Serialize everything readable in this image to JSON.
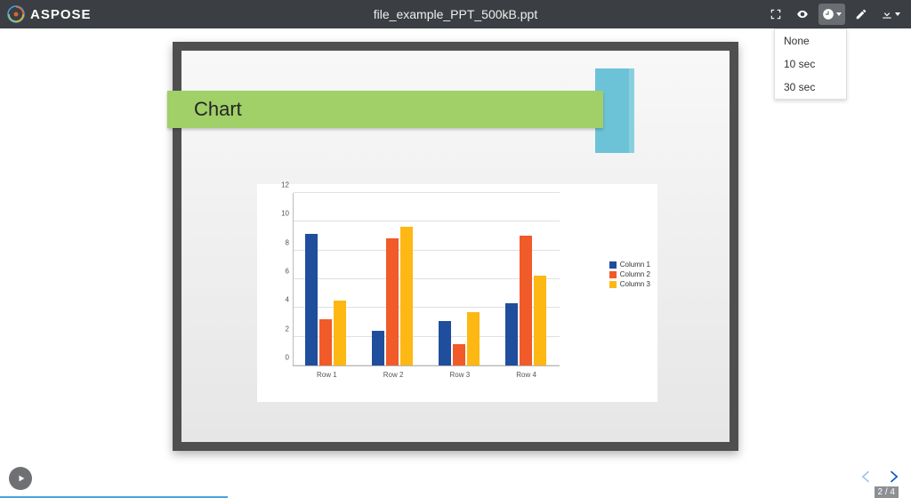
{
  "brand": "ASPOSE",
  "header": {
    "filename": "file_example_PPT_500kB.ppt"
  },
  "dropdown": {
    "opt1": "None",
    "opt2": "10 sec",
    "opt3": "30 sec"
  },
  "slide": {
    "title": "Chart",
    "legend": {
      "c1": "Column 1",
      "c2": "Column 2",
      "c3": "Column 3"
    }
  },
  "chart_data": {
    "type": "bar",
    "categories": [
      "Row 1",
      "Row 2",
      "Row 3",
      "Row 4"
    ],
    "series": [
      {
        "name": "Column 1",
        "values": [
          9.1,
          2.4,
          3.1,
          4.3
        ]
      },
      {
        "name": "Column 2",
        "values": [
          3.2,
          8.8,
          1.5,
          9.0
        ]
      },
      {
        "name": "Column 3",
        "values": [
          4.5,
          9.6,
          3.7,
          6.2
        ]
      }
    ],
    "title": "",
    "xlabel": "",
    "ylabel": "",
    "ylim": [
      0,
      12
    ],
    "yticks": [
      0,
      2,
      4,
      6,
      8,
      10,
      12
    ]
  },
  "pager": {
    "current": 2,
    "total": 4,
    "display": "2 / 4"
  }
}
